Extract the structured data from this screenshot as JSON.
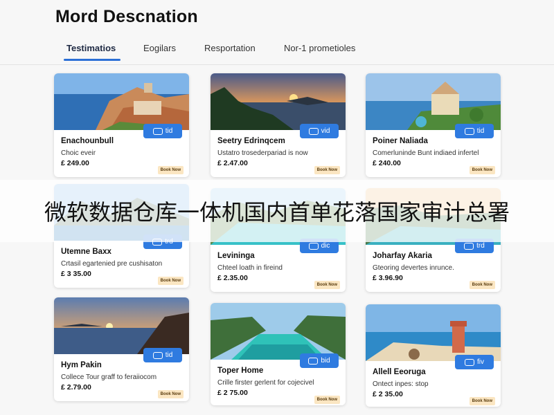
{
  "page": {
    "title": "Mord Descnation",
    "tabs": [
      {
        "label": "Testimatios",
        "active": true
      },
      {
        "label": "Eogilars",
        "active": false
      },
      {
        "label": "Resportation",
        "active": false
      },
      {
        "label": "Nor-1 prometioles",
        "active": false
      }
    ]
  },
  "cards": [
    {
      "name": "Enachounbull",
      "desc": "Choic eveir",
      "price": "£ 249.00",
      "pill": "tid",
      "book": "Book Now",
      "scene": "coastal-village"
    },
    {
      "name": "Seetry Edrinqcem",
      "desc": "Ustatro trosederpariad is now",
      "price": "£ 2.47.00",
      "pill": "vid",
      "book": "Book Now",
      "scene": "sunset-bay"
    },
    {
      "name": "Poiner Naliada",
      "desc": "Comerluninde Bunt indiaed infertel",
      "price": "£ 240.00",
      "pill": "tid",
      "book": "Book Now",
      "scene": "villa-cliff"
    },
    {
      "name": "Utemne Baxx",
      "desc": "Crtasil egartenied pre cushisaton",
      "price": "£ 3 35.00",
      "pill": "trd",
      "book": "Book Now",
      "scene": "mountain-sea"
    },
    {
      "name": "Levininga",
      "desc": "Chteel loath in fireind",
      "price": "£ 2.35.00",
      "pill": "dic",
      "book": "Book Now",
      "scene": "turquoise-bay"
    },
    {
      "name": "Joharfay Akaria",
      "desc": "Gteoring devertes inrunce.",
      "price": "£ 3.96.90",
      "pill": "trd",
      "book": "Book Now",
      "scene": "cove-sunset"
    },
    {
      "name": "Hym Pakin",
      "desc": "Collece Tour graff to feraiiocom",
      "price": "£ 2.79.00",
      "pill": "tid",
      "book": "Book Now",
      "scene": "sunset-islands"
    },
    {
      "name": "Toper Home",
      "desc": "Crille firster gerlent for cojecivel",
      "price": "£ 2 75.00",
      "pill": "bid",
      "book": "Book Now",
      "scene": "lagoon-cliffs"
    },
    {
      "name": "Allell Eeoruga",
      "desc": "Ontect inpes: stop",
      "price": "£ 2 35.00",
      "pill": "fiv",
      "book": "Book Now",
      "scene": "beach-lighthouse"
    }
  ],
  "banner": {
    "text": "微软数据仓库一体机国内首单花落国家审计总署"
  },
  "colors": {
    "accent": "#2f7be0",
    "tab_underline": "#2b6fd6",
    "book_bg": "#fbe6c2",
    "page_bg": "#f7f7f7"
  }
}
